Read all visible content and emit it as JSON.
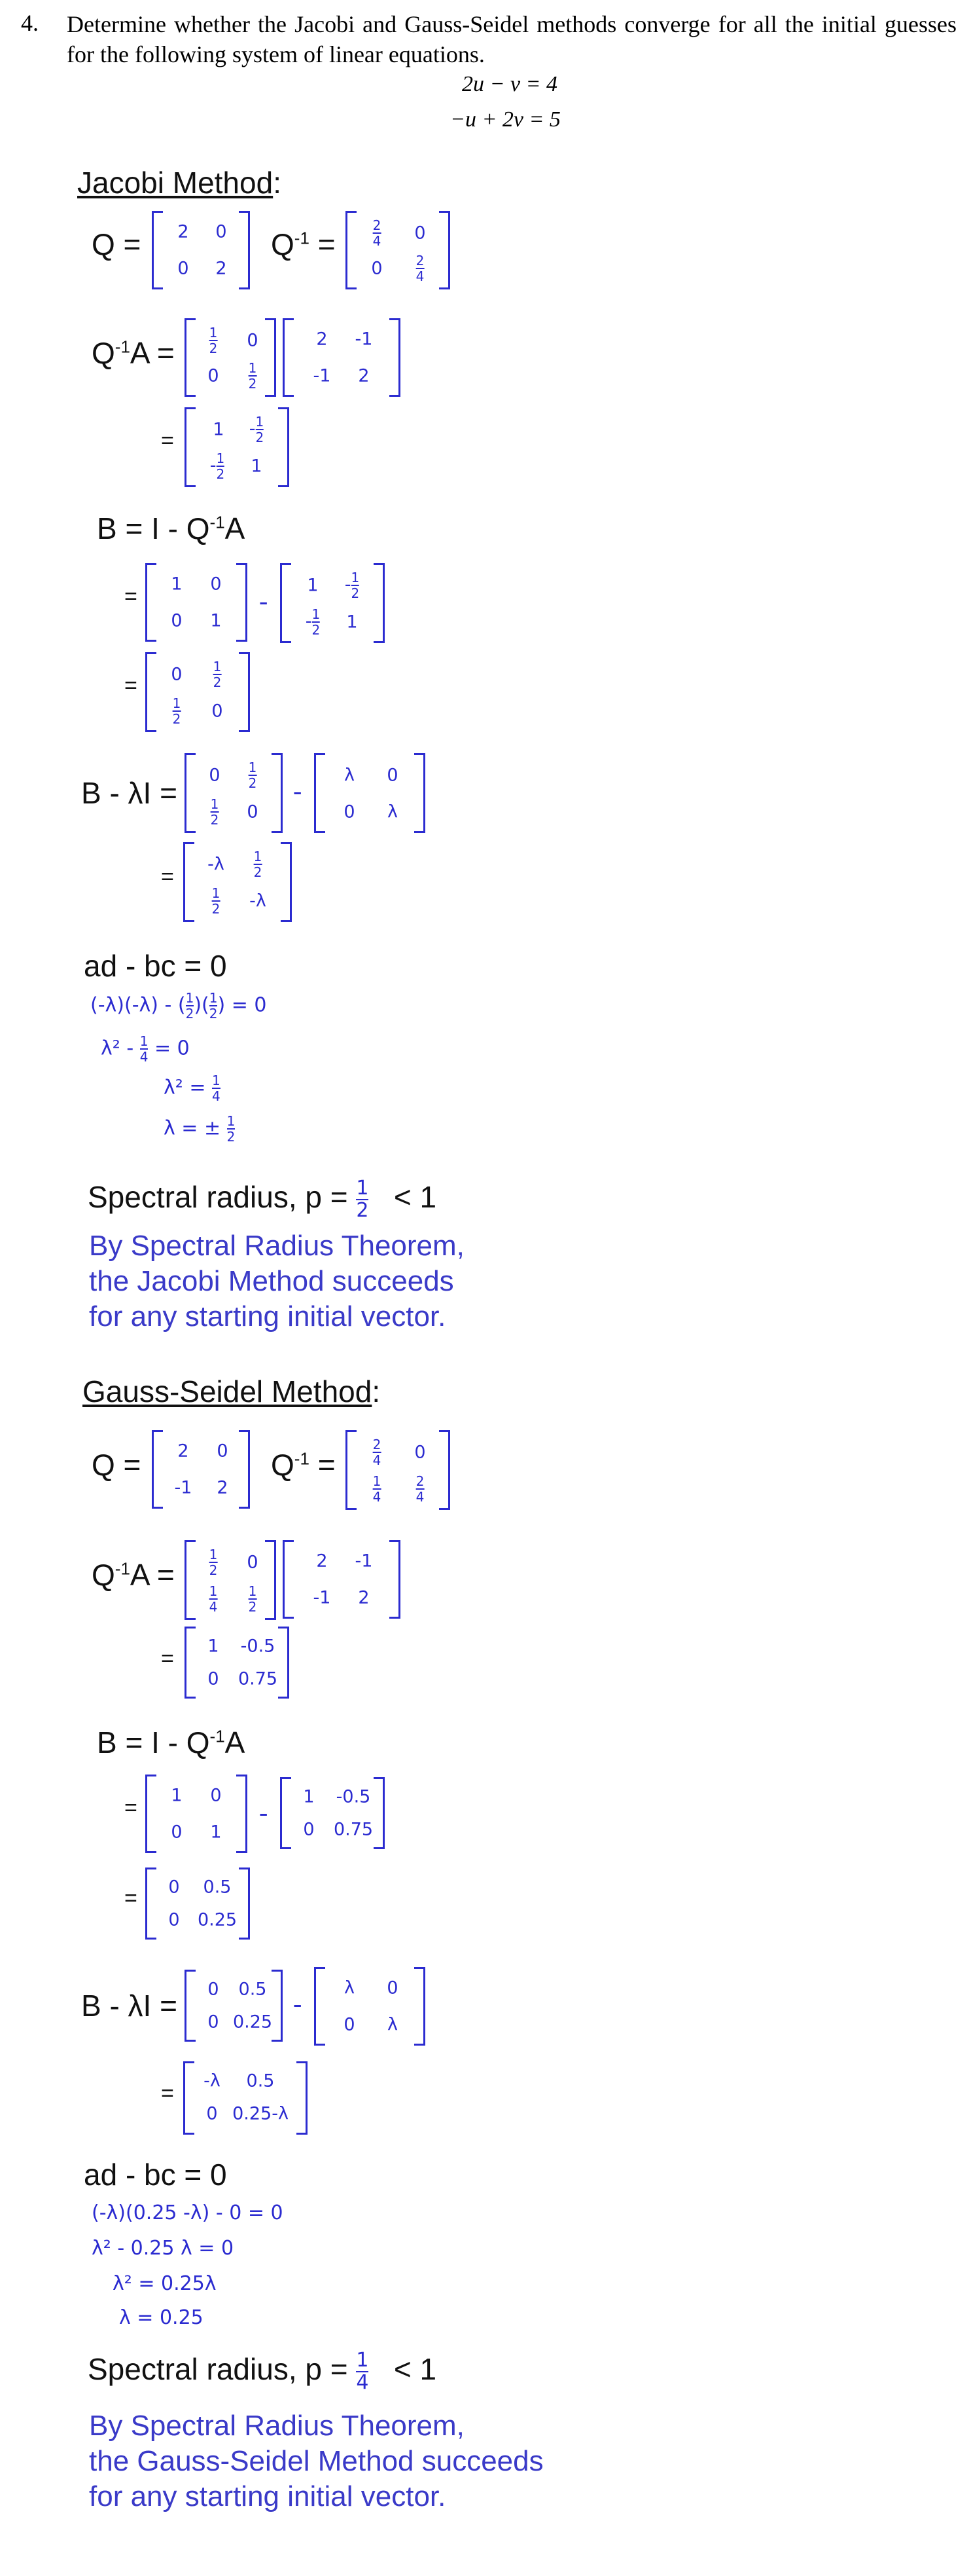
{
  "problem": {
    "number": "4.",
    "text": "Determine whether the Jacobi and Gauss-Seidel methods converge for all the initial guesses for the following system of linear equations.",
    "eq1": "2u − v = 4",
    "eq2": "−u + 2v = 5"
  },
  "jacobi": {
    "heading": "Jacobi Method",
    "colon": ":",
    "q_label": "Q =",
    "qinv_label": "Q",
    "qinv_sup": "-1",
    "eq_sign": "=",
    "q": [
      "2",
      "0",
      "0",
      "2"
    ],
    "qinv_n": [
      "2",
      "0",
      "0",
      "2"
    ],
    "qinv_d": [
      "4",
      "",
      "",
      "4"
    ],
    "qa_label": "Q",
    "qa_sup": "-1",
    "qa_tail": "A =",
    "half": "1",
    "half_d": "2",
    "a": [
      "2",
      "-1",
      "-1",
      "2"
    ],
    "qa_res": [
      "1",
      "-",
      "-",
      "1"
    ],
    "b_label": "B = I - Q",
    "b_sup": "-1",
    "b_tail": "A",
    "ident": [
      "1",
      "0",
      "0",
      "1"
    ],
    "zero": "0",
    "b_lambda_label": "B - λI =",
    "lambda": "λ",
    "neg_lambda": "-λ",
    "det_label": "ad - bc = 0",
    "det_line1": "(-λ)(-λ) - (",
    "det_line1b": ")(",
    "det_line1c": ") = 0",
    "det_line2": "λ² - ",
    "det_line2b": " = 0",
    "four": "4",
    "det_line3": "λ² = ",
    "det_line4": "λ = ± ",
    "sr_label": "Spectral radius, p =",
    "sr_tail": "< 1",
    "conclusion": [
      "By Spectral Radius Theorem,",
      "the Jacobi Method succeeds",
      "for any starting initial vector."
    ]
  },
  "gauss": {
    "heading": "Gauss-Seidel Method",
    "colon": ":",
    "q": [
      "2",
      "0",
      "-1",
      "2"
    ],
    "qinv_n": [
      "2",
      "0",
      "1",
      "2"
    ],
    "qinv_d": [
      "4",
      "",
      "4",
      "4"
    ],
    "qa_col1": [
      "1",
      "1"
    ],
    "qa_col1_d": [
      "2",
      "4"
    ],
    "qa_res": [
      "1",
      "-0.5",
      "0",
      "0.75"
    ],
    "b_res": [
      "0",
      "0.5",
      "0",
      "0.25"
    ],
    "bl_res": [
      "-λ",
      "0.5",
      "0",
      "0.25-λ"
    ],
    "det_line1": "(-λ)(0.25 -λ) - 0 = 0",
    "det_line2": "λ² - 0.25 λ = 0",
    "det_line3": "λ² = 0.25λ",
    "det_line4": "λ = 0.25",
    "sr_num": "1",
    "sr_den": "4",
    "conclusion": [
      "By Spectral Radius Theorem,",
      "the Gauss-Seidel Method succeeds",
      "for any starting initial vector."
    ]
  }
}
